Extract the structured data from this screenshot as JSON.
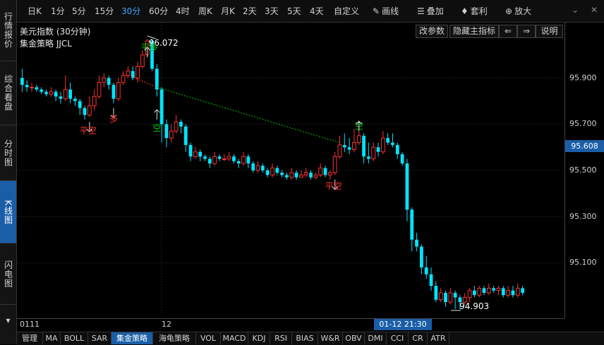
{
  "left_tabs": [
    {
      "label": "行情报价"
    },
    {
      "label": "综合看盘"
    },
    {
      "label": "分时图"
    },
    {
      "label": "K线图"
    },
    {
      "label": "闪电图"
    }
  ],
  "periods": [
    "日K",
    "1分",
    "5分",
    "15分",
    "30分",
    "60分",
    "4时",
    "周K",
    "月K",
    "2天",
    "3天",
    "5天",
    "4天",
    "自定义"
  ],
  "active_period": "30分",
  "toolbar": {
    "draw": "画线",
    "overlay": "叠加",
    "arbitrage": "套利",
    "zoom": "放大"
  },
  "chart": {
    "title": "美元指数 (30分钟)",
    "strategy": "集金策略 JJCL",
    "btn_params": "改参数",
    "btn_hide": "隐藏主指标",
    "btn_left": "⇐",
    "btn_right": "⇒",
    "btn_help": "说明"
  },
  "price_axis": {
    "labels": [
      "95.900",
      "95.700",
      "95.500",
      "95.300",
      "95.100"
    ],
    "current": "95.608"
  },
  "time_axis": {
    "start": "0111",
    "day": "12",
    "cursor": "01-12 21:30"
  },
  "annotations": {
    "high": "96.072",
    "low": "94.903",
    "ping_kong": "平空",
    "ping_duo": "平多",
    "duo": "多",
    "kong": "空"
  },
  "bottom_tabs": [
    "管理",
    "MA",
    "BOLL",
    "SAR",
    "集金策略",
    "海龟策略",
    "VOL",
    "MACD",
    "KDJ",
    "RSI",
    "BIAS",
    "W&R",
    "OBV",
    "DMI",
    "CCI",
    "CR",
    "ATR"
  ],
  "active_bottom": "集金策略",
  "colors": {
    "up": "#ff3232",
    "down": "#00e5ff",
    "accent": "#1a5ea8",
    "signal_dash": "#00c800"
  },
  "chart_data": {
    "type": "candlestick",
    "y_range": [
      94.86,
      96.14
    ],
    "ticks": [
      95.9,
      95.7,
      95.5,
      95.3,
      95.1
    ],
    "candles": [
      [
        95.9,
        95.87,
        95.94,
        95.84
      ],
      [
        95.87,
        95.86,
        95.89,
        95.84
      ],
      [
        95.86,
        95.86,
        95.88,
        95.84
      ],
      [
        95.86,
        95.85,
        95.87,
        95.84
      ],
      [
        95.85,
        95.84,
        95.86,
        95.83
      ],
      [
        95.84,
        95.83,
        95.85,
        95.82
      ],
      [
        95.83,
        95.84,
        95.86,
        95.82
      ],
      [
        95.84,
        95.82,
        95.85,
        95.8
      ],
      [
        95.82,
        95.81,
        95.84,
        95.79
      ],
      [
        95.81,
        95.85,
        95.91,
        95.8
      ],
      [
        95.85,
        95.81,
        95.88,
        95.79
      ],
      [
        95.81,
        95.8,
        95.82,
        95.78
      ],
      [
        95.8,
        95.77,
        95.81,
        95.74
      ],
      [
        95.77,
        95.74,
        95.78,
        95.72
      ],
      [
        95.74,
        95.78,
        95.82,
        95.73
      ],
      [
        95.78,
        95.82,
        95.85,
        95.76
      ],
      [
        95.82,
        95.88,
        95.91,
        95.81
      ],
      [
        95.88,
        95.9,
        95.92,
        95.86
      ],
      [
        95.9,
        95.87,
        95.91,
        95.85
      ],
      [
        95.87,
        95.81,
        95.88,
        95.79
      ],
      [
        95.81,
        95.88,
        95.9,
        95.8
      ],
      [
        95.88,
        95.91,
        95.93,
        95.87
      ],
      [
        95.91,
        95.93,
        95.95,
        95.9
      ],
      [
        95.93,
        95.9,
        95.95,
        95.89
      ],
      [
        95.9,
        95.95,
        95.97,
        95.88
      ],
      [
        95.95,
        96.0,
        96.02,
        95.94
      ],
      [
        96.0,
        96.06,
        96.07,
        95.99
      ],
      [
        96.06,
        95.94,
        96.07,
        95.93
      ],
      [
        95.94,
        95.85,
        95.96,
        95.82
      ],
      [
        95.85,
        95.7,
        95.86,
        95.62
      ],
      [
        95.7,
        95.64,
        95.72,
        95.6
      ],
      [
        95.64,
        95.67,
        95.7,
        95.62
      ],
      [
        95.67,
        95.71,
        95.74,
        95.66
      ],
      [
        95.71,
        95.69,
        95.72,
        95.66
      ],
      [
        95.69,
        95.61,
        95.7,
        95.58
      ],
      [
        95.61,
        95.56,
        95.62,
        95.54
      ],
      [
        95.56,
        95.58,
        95.6,
        95.55
      ],
      [
        95.58,
        95.56,
        95.59,
        95.54
      ],
      [
        95.56,
        95.55,
        95.57,
        95.54
      ],
      [
        95.55,
        95.53,
        95.56,
        95.51
      ],
      [
        95.53,
        95.56,
        95.58,
        95.52
      ],
      [
        95.56,
        95.55,
        95.57,
        95.54
      ],
      [
        95.55,
        95.55,
        95.57,
        95.54
      ],
      [
        95.55,
        95.56,
        95.58,
        95.54
      ],
      [
        95.56,
        95.54,
        95.57,
        95.53
      ],
      [
        95.54,
        95.53,
        95.55,
        95.51
      ],
      [
        95.53,
        95.56,
        95.58,
        95.52
      ],
      [
        95.56,
        95.53,
        95.57,
        95.51
      ],
      [
        95.53,
        95.5,
        95.54,
        95.49
      ],
      [
        95.5,
        95.52,
        95.54,
        95.49
      ],
      [
        95.52,
        95.5,
        95.53,
        95.49
      ],
      [
        95.5,
        95.48,
        95.51,
        95.47
      ],
      [
        95.48,
        95.51,
        95.53,
        95.47
      ],
      [
        95.51,
        95.49,
        95.52,
        95.48
      ],
      [
        95.49,
        95.48,
        95.5,
        95.47
      ],
      [
        95.48,
        95.47,
        95.49,
        95.46
      ],
      [
        95.47,
        95.49,
        95.51,
        95.46
      ],
      [
        95.49,
        95.47,
        95.5,
        95.46
      ],
      [
        95.47,
        95.48,
        95.5,
        95.47
      ],
      [
        95.48,
        95.49,
        95.51,
        95.47
      ],
      [
        95.49,
        95.47,
        95.5,
        95.46
      ],
      [
        95.47,
        95.48,
        95.49,
        95.46
      ],
      [
        95.48,
        95.51,
        95.53,
        95.47
      ],
      [
        95.51,
        95.48,
        95.52,
        95.47
      ],
      [
        95.48,
        95.49,
        95.5,
        95.46
      ],
      [
        95.49,
        95.56,
        95.58,
        95.48
      ],
      [
        95.56,
        95.61,
        95.65,
        95.55
      ],
      [
        95.61,
        95.6,
        95.66,
        95.58
      ],
      [
        95.6,
        95.59,
        95.64,
        95.57
      ],
      [
        95.59,
        95.62,
        95.68,
        95.58
      ],
      [
        95.62,
        95.65,
        95.67,
        95.61
      ],
      [
        95.65,
        95.56,
        95.66,
        95.53
      ],
      [
        95.56,
        95.55,
        95.62,
        95.53
      ],
      [
        95.55,
        95.6,
        95.62,
        95.54
      ],
      [
        95.6,
        95.58,
        95.62,
        95.56
      ],
      [
        95.58,
        95.64,
        95.67,
        95.57
      ],
      [
        95.64,
        95.62,
        95.66,
        95.61
      ],
      [
        95.62,
        95.61,
        95.66,
        95.6
      ],
      [
        95.61,
        95.57,
        95.62,
        95.55
      ],
      [
        95.57,
        95.53,
        95.58,
        95.52
      ],
      [
        95.53,
        95.33,
        95.55,
        95.28
      ],
      [
        95.33,
        95.2,
        95.34,
        95.15
      ],
      [
        95.2,
        95.17,
        95.23,
        95.15
      ],
      [
        95.17,
        95.08,
        95.18,
        95.05
      ],
      [
        95.08,
        95.05,
        95.13,
        95.03
      ],
      [
        95.05,
        95.0,
        95.08,
        94.98
      ],
      [
        95.0,
        94.94,
        95.02,
        94.93
      ],
      [
        94.94,
        94.97,
        94.99,
        94.93
      ],
      [
        94.97,
        94.93,
        94.98,
        94.91
      ],
      [
        94.93,
        94.97,
        94.99,
        94.92
      ],
      [
        94.97,
        94.95,
        94.98,
        94.9
      ],
      [
        94.95,
        94.93,
        94.96,
        94.9
      ],
      [
        94.93,
        94.95,
        94.97,
        94.92
      ],
      [
        94.95,
        94.98,
        94.99,
        94.93
      ],
      [
        94.98,
        94.96,
        95.0,
        94.95
      ],
      [
        94.96,
        94.99,
        95.0,
        94.95
      ],
      [
        94.99,
        94.97,
        95.0,
        94.96
      ],
      [
        94.97,
        94.99,
        95.01,
        94.96
      ],
      [
        94.99,
        94.98,
        95.0,
        94.97
      ],
      [
        94.98,
        94.99,
        95.0,
        94.96
      ],
      [
        94.99,
        94.96,
        95.0,
        94.95
      ],
      [
        94.96,
        94.98,
        95.0,
        94.95
      ],
      [
        94.98,
        94.96,
        95.0,
        94.95
      ],
      [
        94.96,
        94.99,
        95.01,
        94.95
      ],
      [
        94.99,
        94.97,
        95.0,
        94.96
      ]
    ]
  }
}
